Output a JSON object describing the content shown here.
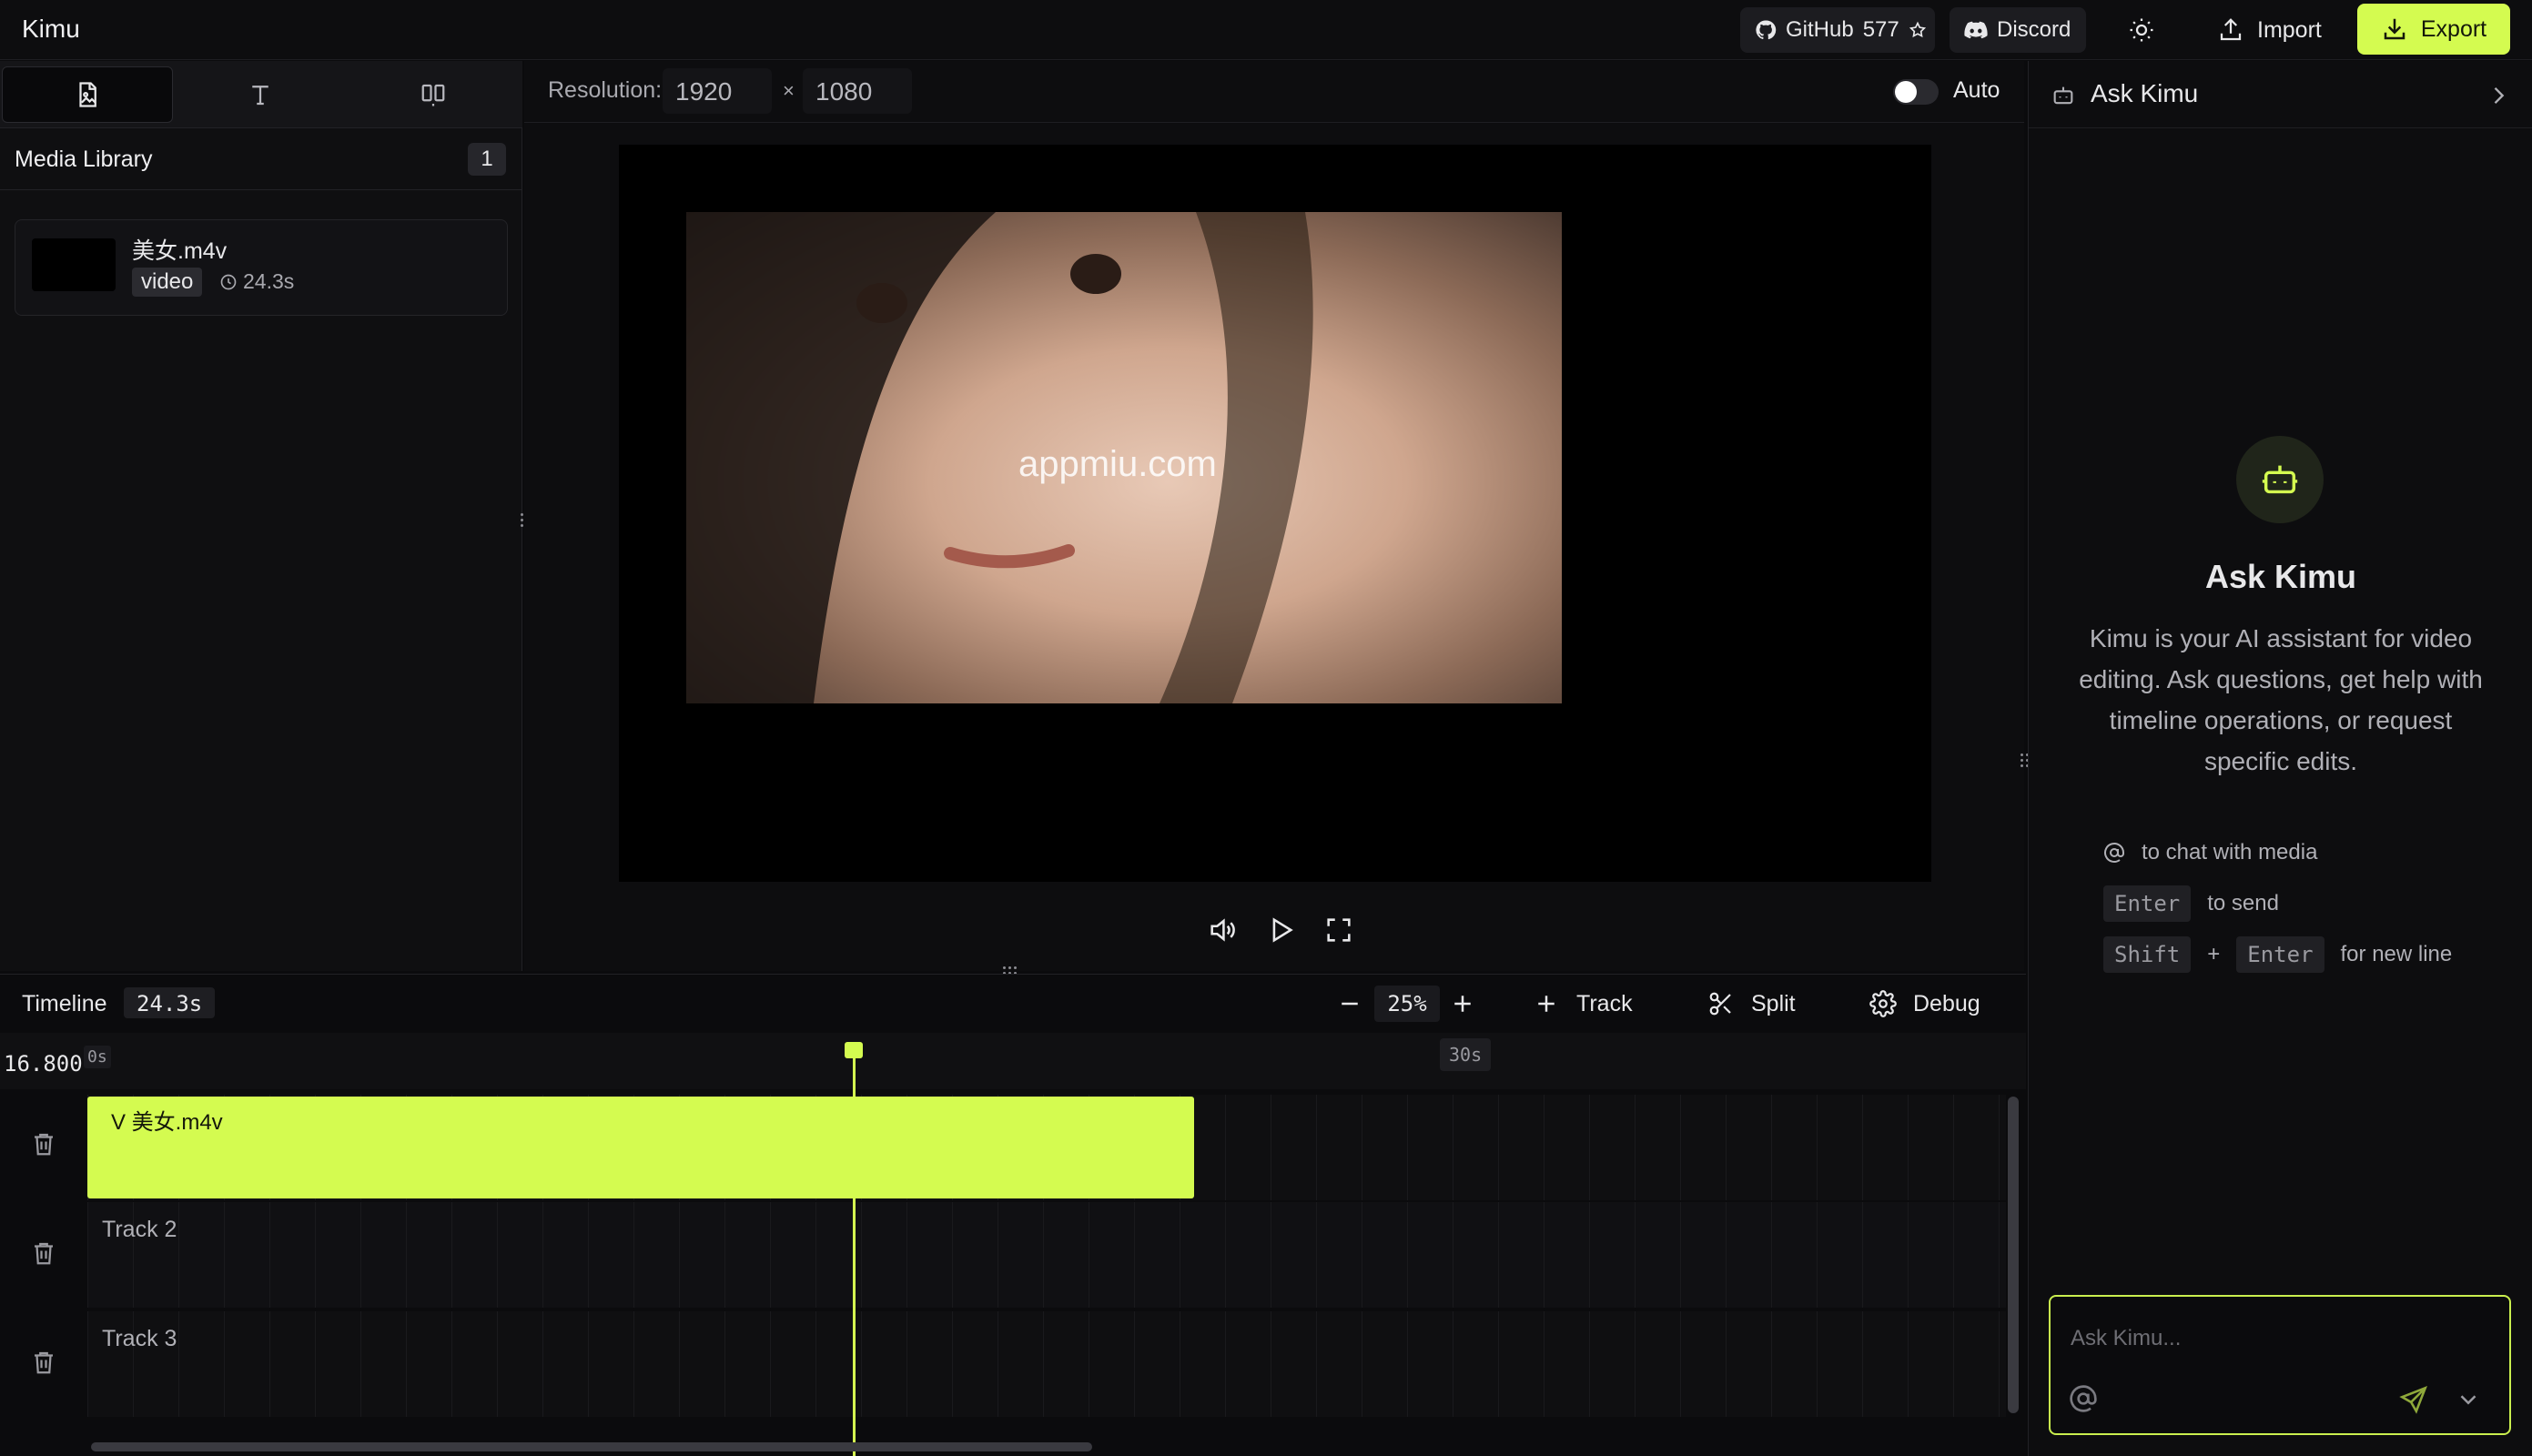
{
  "app": {
    "title": "Kimu"
  },
  "topbar": {
    "github": {
      "label": "GitHub",
      "stars": "577"
    },
    "discord": {
      "label": "Discord"
    },
    "import_label": "Import",
    "export_label": "Export"
  },
  "left_panel": {
    "tabs": [
      {
        "icon": "media-file-icon",
        "active": true
      },
      {
        "icon": "text-icon",
        "active": false
      },
      {
        "icon": "transitions-icon",
        "active": false
      }
    ],
    "media_library": {
      "title": "Media Library",
      "count": "1",
      "items": [
        {
          "name": "美女.m4v",
          "type": "video",
          "duration": "24.3s"
        }
      ]
    }
  },
  "preview": {
    "resolution_label": "Resolution:",
    "width": "1920",
    "height": "1080",
    "times_symbol": "×",
    "auto_label": "Auto",
    "auto_enabled": false
  },
  "timeline": {
    "title": "Timeline",
    "duration": "24.3s",
    "zoom": "25%",
    "track_label": "Track",
    "split_label": "Split",
    "debug_label": "Debug",
    "current_time": "16.800",
    "ticks": [
      "0s",
      "30s"
    ],
    "playhead_seconds": 16.8,
    "tracks": [
      {
        "label": "",
        "clip": {
          "label": "V 美女.m4v",
          "start_s": 0,
          "end_s": 24.3
        }
      },
      {
        "label": "Track 2"
      },
      {
        "label": "Track 3"
      }
    ]
  },
  "ask_panel": {
    "header": "Ask Kimu",
    "title": "Ask Kimu",
    "description": "Kimu is your AI assistant for video editing. Ask questions, get help with timeline operations, or request specific edits.",
    "hints": {
      "mention": "to chat with media",
      "send_key": "Enter",
      "send": "to send",
      "shift_key": "Shift",
      "plus": "+",
      "enter_key": "Enter",
      "newline": "for new line"
    },
    "input_placeholder": "Ask Kimu..."
  },
  "colors": {
    "accent": "#d4fb50",
    "background": "#0b0b0d"
  }
}
